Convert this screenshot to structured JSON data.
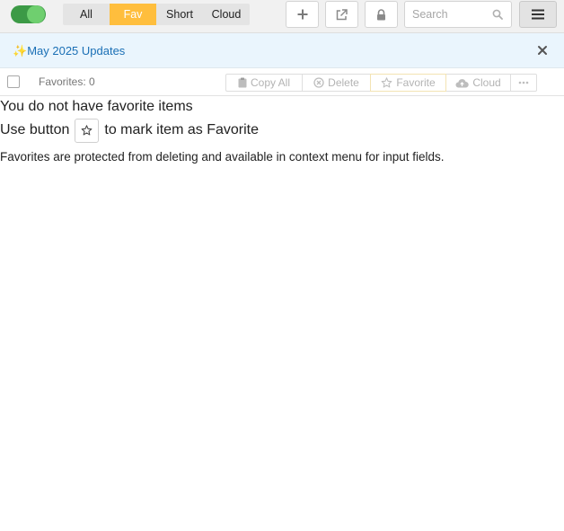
{
  "toolbar": {
    "toggle_on": true,
    "tabs": [
      {
        "label": "All",
        "active": false
      },
      {
        "label": "Fav",
        "active": true
      },
      {
        "label": "Short",
        "active": false
      },
      {
        "label": "Cloud",
        "active": false
      }
    ],
    "icons": {
      "add": "plus-icon",
      "popout": "external-link-icon",
      "lock": "lock-icon",
      "search": "search-icon",
      "menu": "hamburger-menu-icon"
    },
    "search": {
      "placeholder": "Search",
      "value": ""
    }
  },
  "banner": {
    "sparkle": "✨",
    "link_text": "May 2025 Updates"
  },
  "actionbar": {
    "favorites_count_label": "Favorites: 0",
    "actions": {
      "copy_all": "Copy All",
      "delete": "Delete",
      "favorite": "Favorite",
      "cloud": "Cloud"
    }
  },
  "empty_state": {
    "title": "You do not have favorite items",
    "line2_before": "Use button",
    "line2_after": "to mark item as Favorite",
    "note": "Favorites are protected from deleting and available in context menu for input fields."
  },
  "colors": {
    "accent_active_tab": "#ffbe3d",
    "toggle_track": "#3c9a46",
    "toggle_knob": "#6fcf6f",
    "banner_bg": "#eaf5fd",
    "banner_link": "#1a6fb5"
  }
}
